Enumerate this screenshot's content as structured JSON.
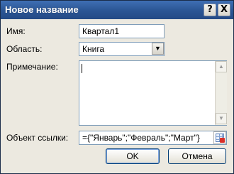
{
  "window": {
    "title": "Новое название",
    "help_glyph": "?",
    "close_glyph": "X"
  },
  "form": {
    "name_label": "Имя:",
    "name_value": "Квартал1",
    "scope_label": "Область:",
    "scope_value": "Книга",
    "comment_label": "Примечание:",
    "comment_value": "",
    "refers_to_label": "Объект ссылки:",
    "refers_to_value": "={\"Январь\";\"Февраль\";\"Март\"}"
  },
  "buttons": {
    "ok_label": "OK",
    "cancel_label": "Отмена"
  },
  "icons": {
    "help": "help-icon",
    "close": "close-icon",
    "dropdown": "chevron-down-icon",
    "scroll_up": "chevron-up-icon",
    "scroll_down": "chevron-down-icon",
    "collapse_dialog": "collapse-dialog-icon"
  }
}
